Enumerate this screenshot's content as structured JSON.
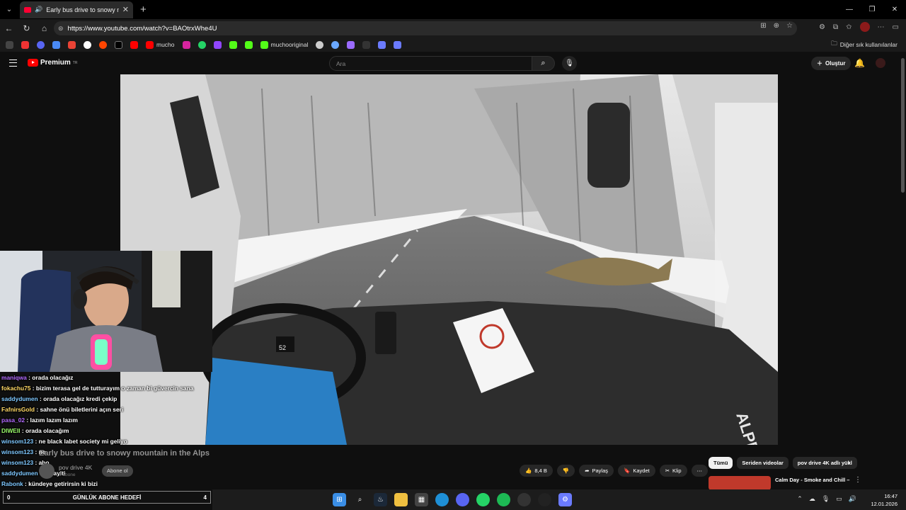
{
  "browser": {
    "tab_title": "Early bus drive to snowy mou",
    "url": "https://www.youtube.com/watch?v=BAOtrxWhe4U",
    "bookmarks": [
      "mucho",
      "muchooriginal"
    ],
    "bookmarks_right": "Diğer sık kullanılanlar"
  },
  "youtube": {
    "logo_text": "Premium",
    "logo_region": "TR",
    "search_placeholder": "Ara",
    "create_label": "Oluştur"
  },
  "video": {
    "title": "Early bus drive to snowy mountain in the Alps",
    "channel": "pov drive 4K",
    "subscribers": "8 abone",
    "subscribe_label": "Abone ol",
    "likes": "8,4 B",
    "share_label": "Paylaş",
    "save_label": "Kaydet",
    "clip_label": "Klip",
    "bus_brand": "ALPBUS",
    "speed": "52"
  },
  "chips": [
    "Tümü",
    "Seriden videolar",
    "pov drive 4K adlı yükl"
  ],
  "recommended": {
    "title": "Calm Day - Smoke and Chill –"
  },
  "chat": [
    {
      "user": "maniqwa",
      "text": "orada olacağız",
      "color": "#b36bff"
    },
    {
      "user": "fokachu75",
      "text": "bizim terasa gel de tutturayım o zaman bi güvercin sana",
      "color": "#ffd966"
    },
    {
      "user": "saddydumen",
      "text": "orada olacağız kredi çekip",
      "color": "#7ec8ff"
    },
    {
      "user": "FafnirsGold",
      "text": "sahne önü biletlerini açın seri",
      "color": "#ffd966"
    },
    {
      "user": "pasa_02",
      "text": "lazım lazım lazım",
      "color": "#b36bff"
    },
    {
      "user": "DIWEII",
      "text": "orada olacağım",
      "color": "#9cff6b"
    },
    {
      "user": "winsom123",
      "text": "ne black labet society mi geliyo",
      "color": "#7ec8ff"
    },
    {
      "user": "winsom123",
      "text": "ne",
      "color": "#7ec8ff"
    },
    {
      "user": "winsom123",
      "text": "abo",
      "color": "#7ec8ff"
    },
    {
      "user": "saddydumen",
      "text": "sosayiti",
      "color": "#7ec8ff"
    },
    {
      "user": "Rabonk",
      "text": "kündeye getirirsin ki bizi",
      "color": "#7ec8ff"
    }
  ],
  "goal": {
    "left": "0",
    "label": "GÜNLÜK ABONE HEDEFİ",
    "right": "4"
  },
  "clock": {
    "time": "16:47",
    "date": "12.01.2026"
  },
  "colors": {
    "youtube_red": "#ff0000",
    "background": "#0f0f0f"
  }
}
